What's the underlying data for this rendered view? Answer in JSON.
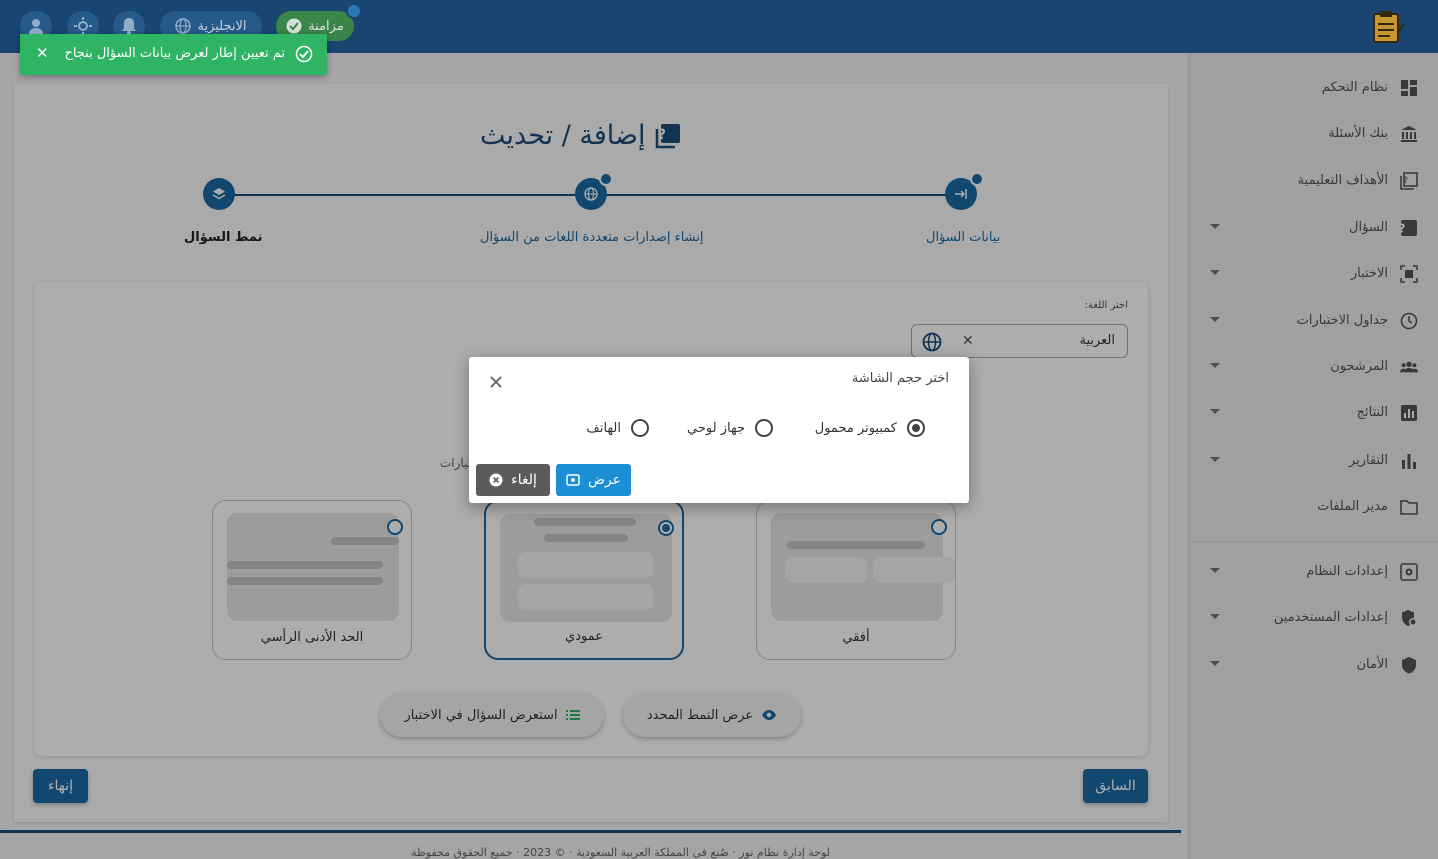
{
  "topbar": {
    "sync_label": "مزامنة",
    "language_label": "الانجليزية"
  },
  "toast": {
    "message": "تم تعيين إطار لعرض بيانات السؤال بنجاح"
  },
  "sidebar": {
    "items": [
      {
        "label": "نظام التحكم",
        "icon": "dashboard-icon",
        "has_caret": false
      },
      {
        "label": "بنك الأسئلة",
        "icon": "bank-icon",
        "has_caret": false
      },
      {
        "label": "الأهداف التعليمية",
        "icon": "objectives-icon",
        "has_caret": false
      },
      {
        "label": "السؤال",
        "icon": "question-icon",
        "has_caret": true
      },
      {
        "label": "الاختبار",
        "icon": "exam-icon",
        "has_caret": true
      },
      {
        "label": "جداول الاختبارات",
        "icon": "clock-icon",
        "has_caret": true
      },
      {
        "label": "المرشحون",
        "icon": "people-icon",
        "has_caret": true
      },
      {
        "label": "النتائج",
        "icon": "results-icon",
        "has_caret": true
      },
      {
        "label": "التقارير",
        "icon": "reports-icon",
        "has_caret": true
      },
      {
        "label": "مدير الملفات",
        "icon": "folder-icon",
        "has_caret": false
      },
      {
        "label": "إعدادات النظام",
        "icon": "system-settings-icon",
        "has_caret": true
      },
      {
        "label": "إعدادات المستخدمين",
        "icon": "user-settings-icon",
        "has_caret": true
      },
      {
        "label": "الأمان",
        "icon": "shield-icon",
        "has_caret": true
      }
    ]
  },
  "page": {
    "title": "إضافة / تحديث",
    "steps": [
      {
        "label": "بيانات السؤال"
      },
      {
        "label": "إنشاء إصدارات متعددة اللغات من السؤال"
      },
      {
        "label": "نمط السؤال"
      }
    ],
    "language_label": "اختر اللغة:",
    "language_value": "العربية",
    "partial_text": "تيارات",
    "layouts": [
      {
        "label": "أفقي"
      },
      {
        "label": "عمودي"
      },
      {
        "label": "الحد الأدنى الرأسي"
      }
    ],
    "view_selected_label": "عرض النمط المحدد",
    "preview_in_exam_label": "استعرض السؤال في الاختبار",
    "previous_label": "السابق",
    "finish_label": "إنهاء",
    "footer_text": "لوحة إدارة نظام نور · صُنع في المملكة العربية السعودية · © 2023 · جميع الحقوق محفوظة"
  },
  "modal": {
    "title": "اختر حجم الشاشة",
    "options": [
      {
        "label": "كمبيوتر محمول"
      },
      {
        "label": "جهاز لوحي"
      },
      {
        "label": "الهاتف"
      }
    ],
    "selected_option": "كمبيوتر محمول",
    "view_label": "عرض",
    "cancel_label": "إلغاء"
  }
}
